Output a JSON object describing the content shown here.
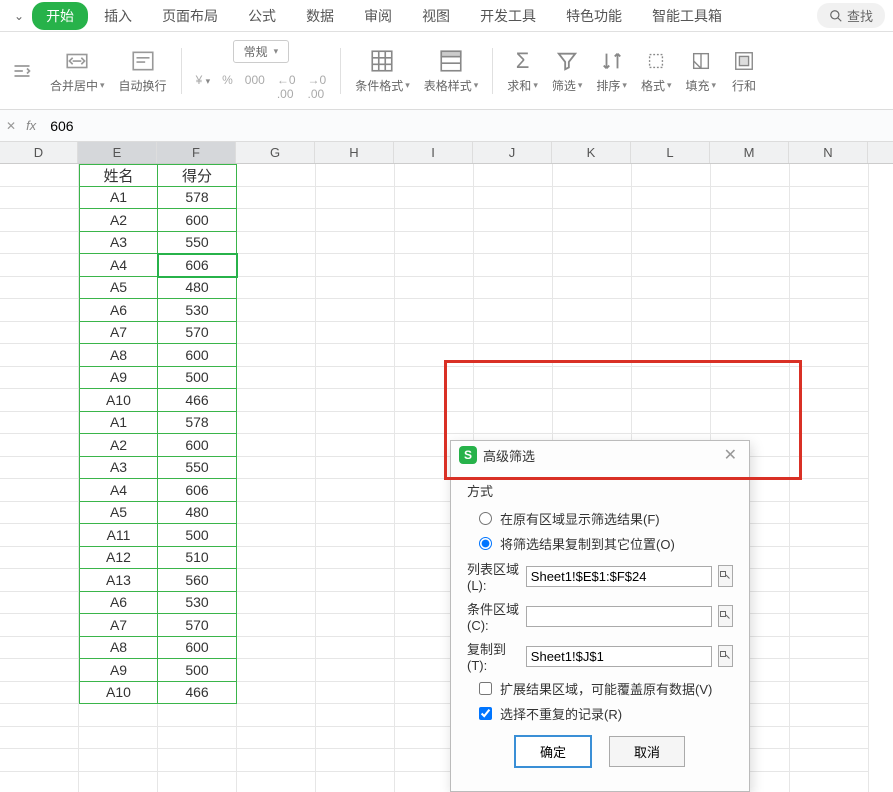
{
  "ribbon": {
    "tabs": [
      "开始",
      "插入",
      "页面布局",
      "公式",
      "数据",
      "审阅",
      "视图",
      "开发工具",
      "特色功能",
      "智能工具箱"
    ],
    "activeTab": "开始",
    "searchLabel": "查找"
  },
  "toolbar": {
    "mergeCenter": "合并居中",
    "autoWrap": "自动换行",
    "numberFormat": "常规",
    "currencySymbol": "¥",
    "percentSymbol": "%",
    "decimalInc": ".00",
    "decimalDec": ".00",
    "conditionalFormat": "条件格式",
    "tableStyle": "表格样式",
    "sum": "求和",
    "filter": "筛选",
    "sort": "排序",
    "format": "格式",
    "fill": "填充",
    "rowsCols": "行和"
  },
  "formulaBar": {
    "fx": "fx",
    "value": "606"
  },
  "columns": [
    "D",
    "E",
    "F",
    "G",
    "H",
    "I",
    "J",
    "K",
    "L",
    "M",
    "N"
  ],
  "selectedCols": [
    "E",
    "F"
  ],
  "activeCellValue": "606",
  "activeCellRef": "F4",
  "table": {
    "headers": [
      "姓名",
      "得分"
    ],
    "rows": [
      [
        "A1",
        "578"
      ],
      [
        "A2",
        "600"
      ],
      [
        "A3",
        "550"
      ],
      [
        "A4",
        "606"
      ],
      [
        "A5",
        "480"
      ],
      [
        "A6",
        "530"
      ],
      [
        "A7",
        "570"
      ],
      [
        "A8",
        "600"
      ],
      [
        "A9",
        "500"
      ],
      [
        "A10",
        "466"
      ],
      [
        "A1",
        "578"
      ],
      [
        "A2",
        "600"
      ],
      [
        "A3",
        "550"
      ],
      [
        "A4",
        "606"
      ],
      [
        "A5",
        "480"
      ],
      [
        "A11",
        "500"
      ],
      [
        "A12",
        "510"
      ],
      [
        "A13",
        "560"
      ],
      [
        "A6",
        "530"
      ],
      [
        "A7",
        "570"
      ],
      [
        "A8",
        "600"
      ],
      [
        "A9",
        "500"
      ],
      [
        "A10",
        "466"
      ]
    ]
  },
  "dialog": {
    "title": "高级筛选",
    "sectionMethod": "方式",
    "radioInPlace": "在原有区域显示筛选结果(F)",
    "radioCopyTo": "将筛选结果复制到其它位置(O)",
    "fieldListRange": "列表区域(L):",
    "valueListRange": "Sheet1!$E$1:$F$24",
    "fieldCriteria": "条件区域(C):",
    "valueCriteria": "",
    "fieldCopyTo": "复制到(T):",
    "valueCopyTo": "Sheet1!$J$1",
    "checkExtend": "扩展结果区域，可能覆盖原有数据(V)",
    "checkUnique": "选择不重复的记录(R)",
    "btnOk": "确定",
    "btnCancel": "取消"
  }
}
